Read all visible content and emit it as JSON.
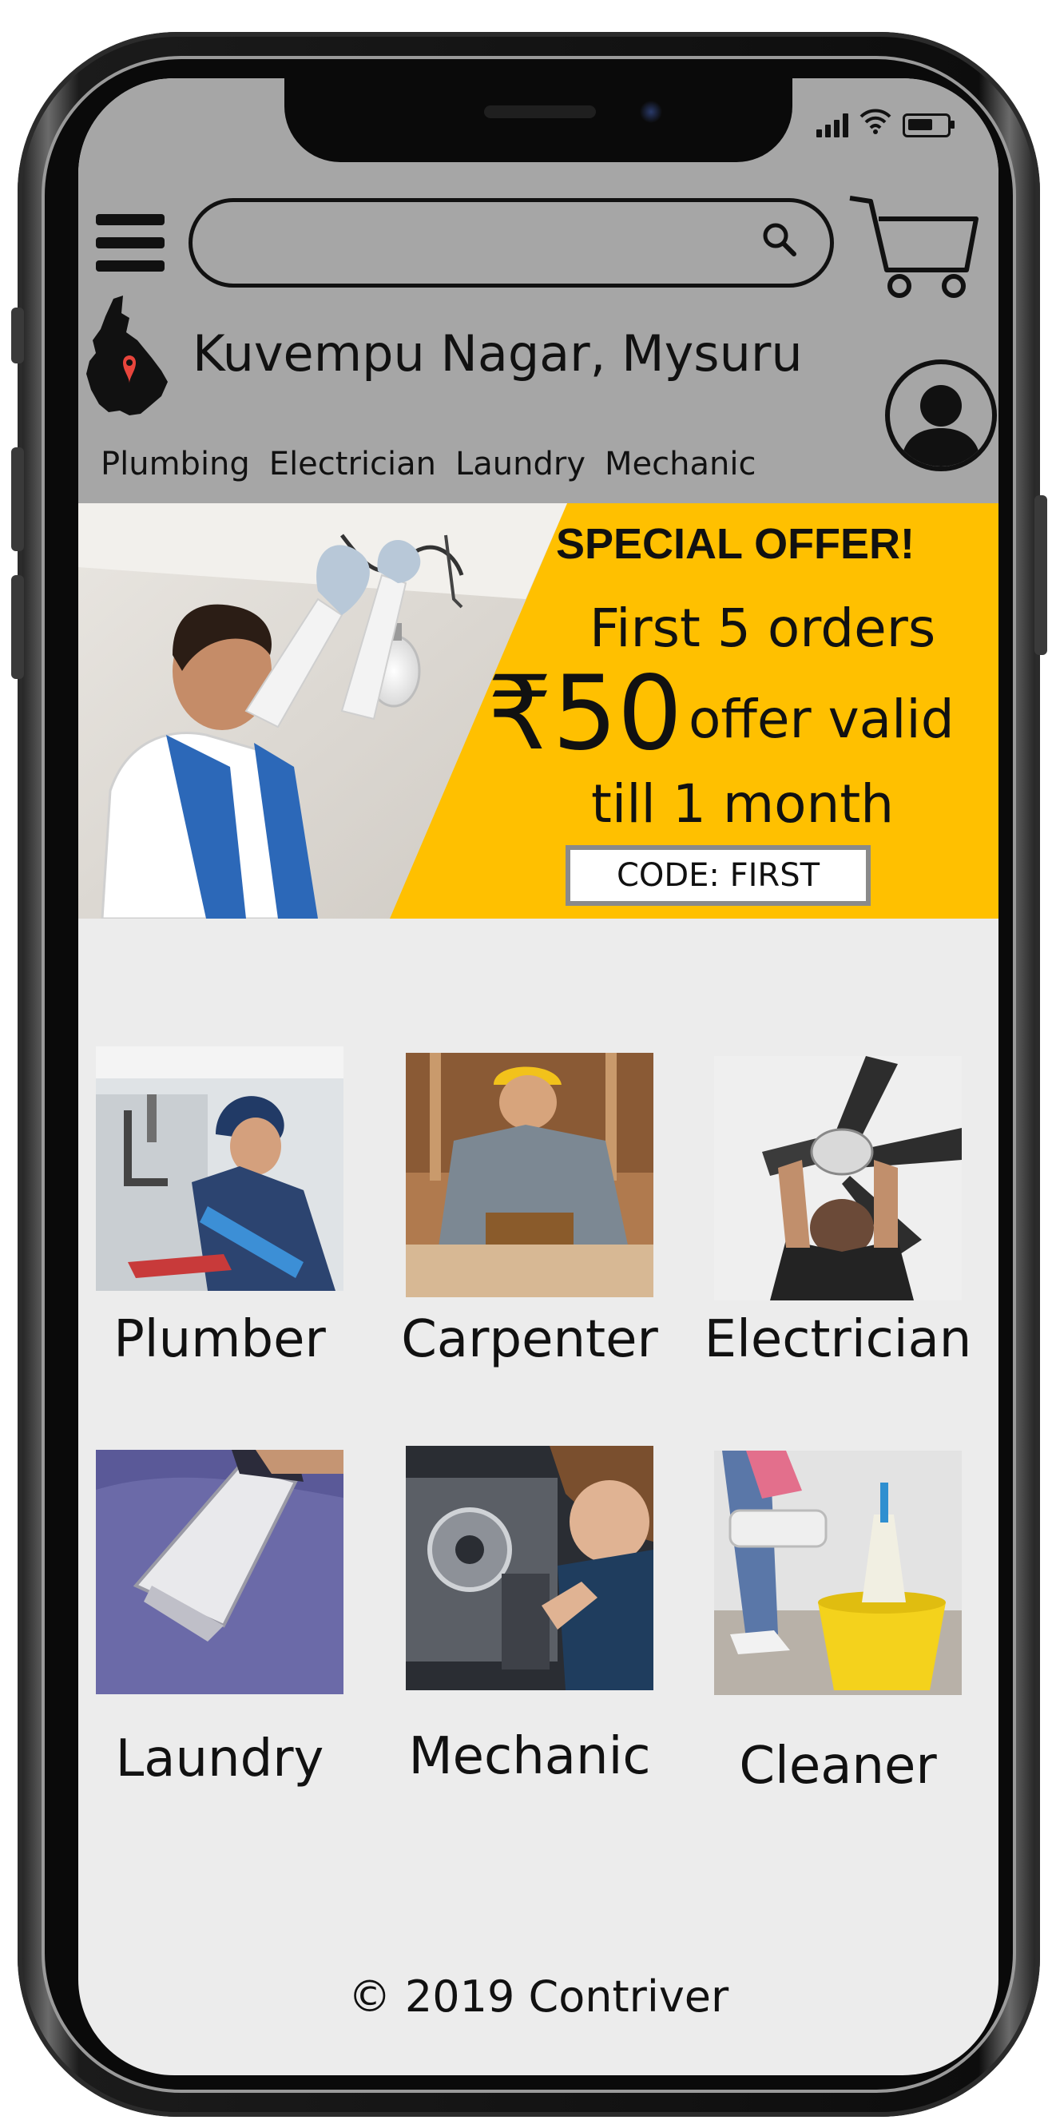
{
  "header": {
    "location": "Kuvempu Nagar, Mysuru",
    "search": {
      "placeholder": ""
    },
    "categories": [
      "Plumbing",
      "Electrician",
      "Laundry",
      "Mechanic"
    ]
  },
  "status_bar": {
    "icons": [
      "signal-icon",
      "wifi-icon",
      "battery-icon"
    ]
  },
  "banner": {
    "title": "SPECIAL OFFER!",
    "line1": "First 5 orders",
    "amount": "₹50",
    "line2": "offer valid",
    "line3": "till 1 month",
    "code": "CODE: FIRST"
  },
  "services": [
    {
      "label": "Plumber",
      "icon": "plumber-photo"
    },
    {
      "label": "Carpenter",
      "icon": "carpenter-photo"
    },
    {
      "label": "Electrician",
      "icon": "electrician-photo"
    },
    {
      "label": "Laundry",
      "icon": "laundry-photo"
    },
    {
      "label": "Mechanic",
      "icon": "mechanic-photo"
    },
    {
      "label": "Cleaner",
      "icon": "cleaner-photo"
    }
  ],
  "footer": {
    "copyright": "© 2019 Contriver"
  },
  "colors": {
    "header_bg": "#a6a6a6",
    "banner_bg": "#ffc000",
    "screen_bg": "#ececec",
    "pin": "#e8453c"
  }
}
